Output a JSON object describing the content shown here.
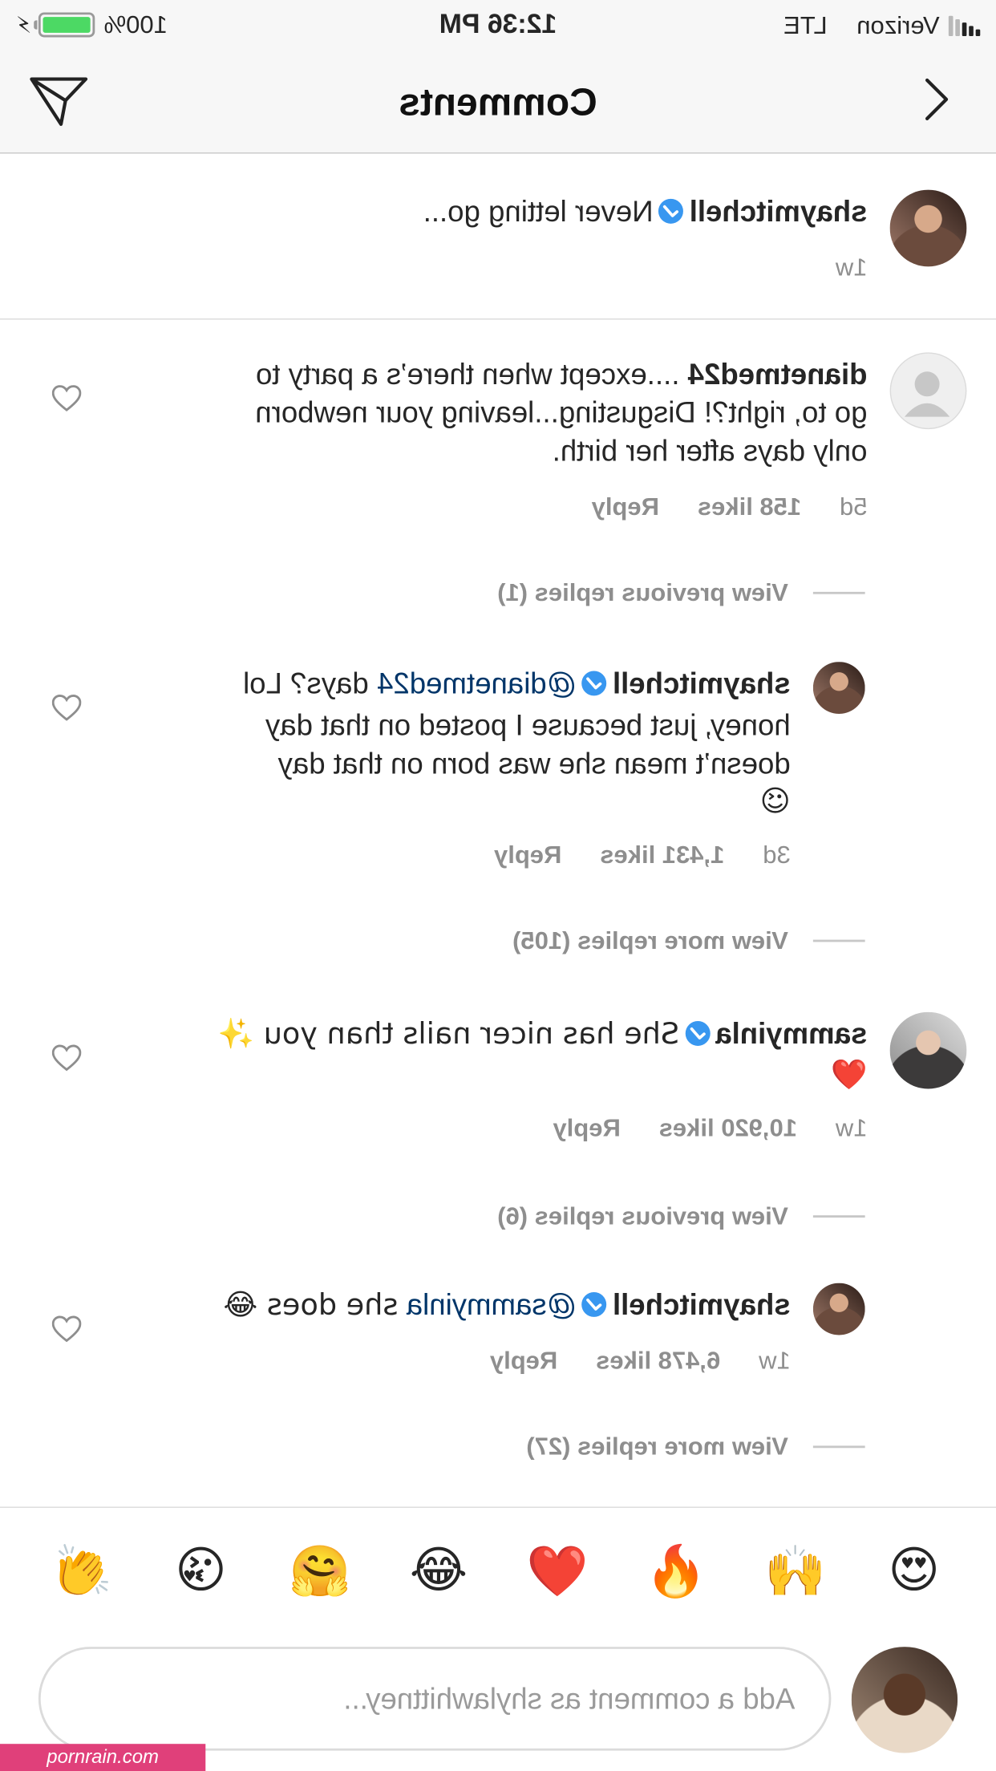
{
  "status_bar": {
    "carrier": "Verizon",
    "network": "LTE",
    "time": "12:36 PM",
    "battery": "100%",
    "battery_level": 1.0
  },
  "nav": {
    "title": "Comments",
    "back_icon": "chevron-left-icon",
    "share_icon": "direct-send-icon"
  },
  "caption": {
    "username": "shaymitchell",
    "text": "Never letting go...",
    "time": "1w"
  },
  "comments": [
    {
      "username": "dianetmed24",
      "text_lines": [
        "....except when there’s a party to",
        "go to, right?! Disgusting...leaving your newborn",
        "only days after her birth."
      ],
      "time": "5d",
      "likes": "158 likes",
      "reply": "Reply",
      "view_replies": "View previous replies (1)"
    },
    {
      "username": "shaymitchell",
      "mention": "@dianetmed24",
      "text_lines": [
        "days? Lol",
        "honey, just because I posted on that day",
        "doesn’t mean she was born on that day",
        "😉"
      ],
      "time": "3d",
      "likes": "1,431 likes",
      "reply": "Reply",
      "view_replies": "View more replies (105)"
    },
    {
      "username": "sammyinla",
      "text_lines": [
        "She has nicer nails than you ✨",
        "❤️"
      ],
      "time": "1w",
      "likes": "10,920 likes",
      "reply": "Reply",
      "view_replies": "View previous replies (6)"
    },
    {
      "username": "shaymitchell",
      "mention": "@sammyinla",
      "text_lines": [
        "she does 😂"
      ],
      "time": "1w",
      "likes": "6,478 likes",
      "reply": "Reply",
      "view_replies": "View more replies (27)"
    }
  ],
  "emoji_bar": [
    "😍",
    "🙌",
    "🔥",
    "❤️",
    "😂",
    "🤗",
    "😘",
    "👏"
  ],
  "composer": {
    "placeholder": "Add a comment as shylawhittney..."
  },
  "watermark": "pornrain.com",
  "colors": {
    "verified": "#3897f0",
    "mention": "#003569",
    "meta": "#8e8e8e",
    "battery": "#4cd964",
    "watermark": "#e0407a"
  }
}
